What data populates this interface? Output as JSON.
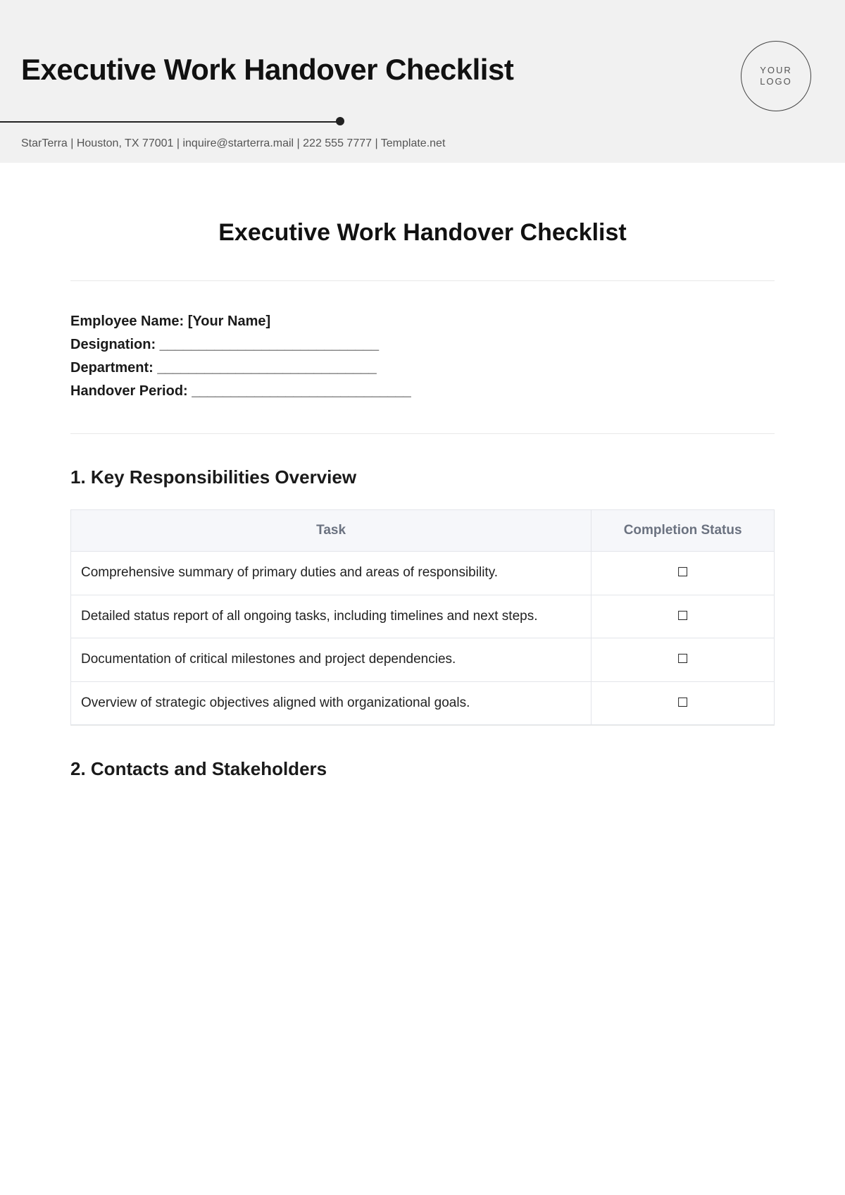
{
  "header": {
    "title": "Executive Work Handover Checklist",
    "logo_line1": "YOUR",
    "logo_line2": "LOGO",
    "meta": "StarTerra | Houston, TX 77001 | inquire@starterra.mail | 222 555 7777 | Template.net"
  },
  "doc": {
    "title": "Executive Work Handover Checklist"
  },
  "fields": {
    "employee": "Employee Name: [Your Name]",
    "designation": "Designation:   ____________________________",
    "department": "Department:   ____________________________",
    "handover_period": "Handover Period:   ____________________________"
  },
  "sections": {
    "s1": {
      "heading": "1. Key Responsibilities Overview",
      "columns": {
        "task": "Task",
        "status": "Completion Status"
      },
      "rows": [
        {
          "task": "Comprehensive summary of primary duties and areas of responsibility.",
          "status": "☐"
        },
        {
          "task": "Detailed status report of all ongoing tasks, including timelines and next steps.",
          "status": "☐"
        },
        {
          "task": "Documentation of critical milestones and project dependencies.",
          "status": "☐"
        },
        {
          "task": "Overview of strategic objectives aligned with organizational goals.",
          "status": "☐"
        }
      ]
    },
    "s2": {
      "heading": "2. Contacts and Stakeholders"
    }
  }
}
